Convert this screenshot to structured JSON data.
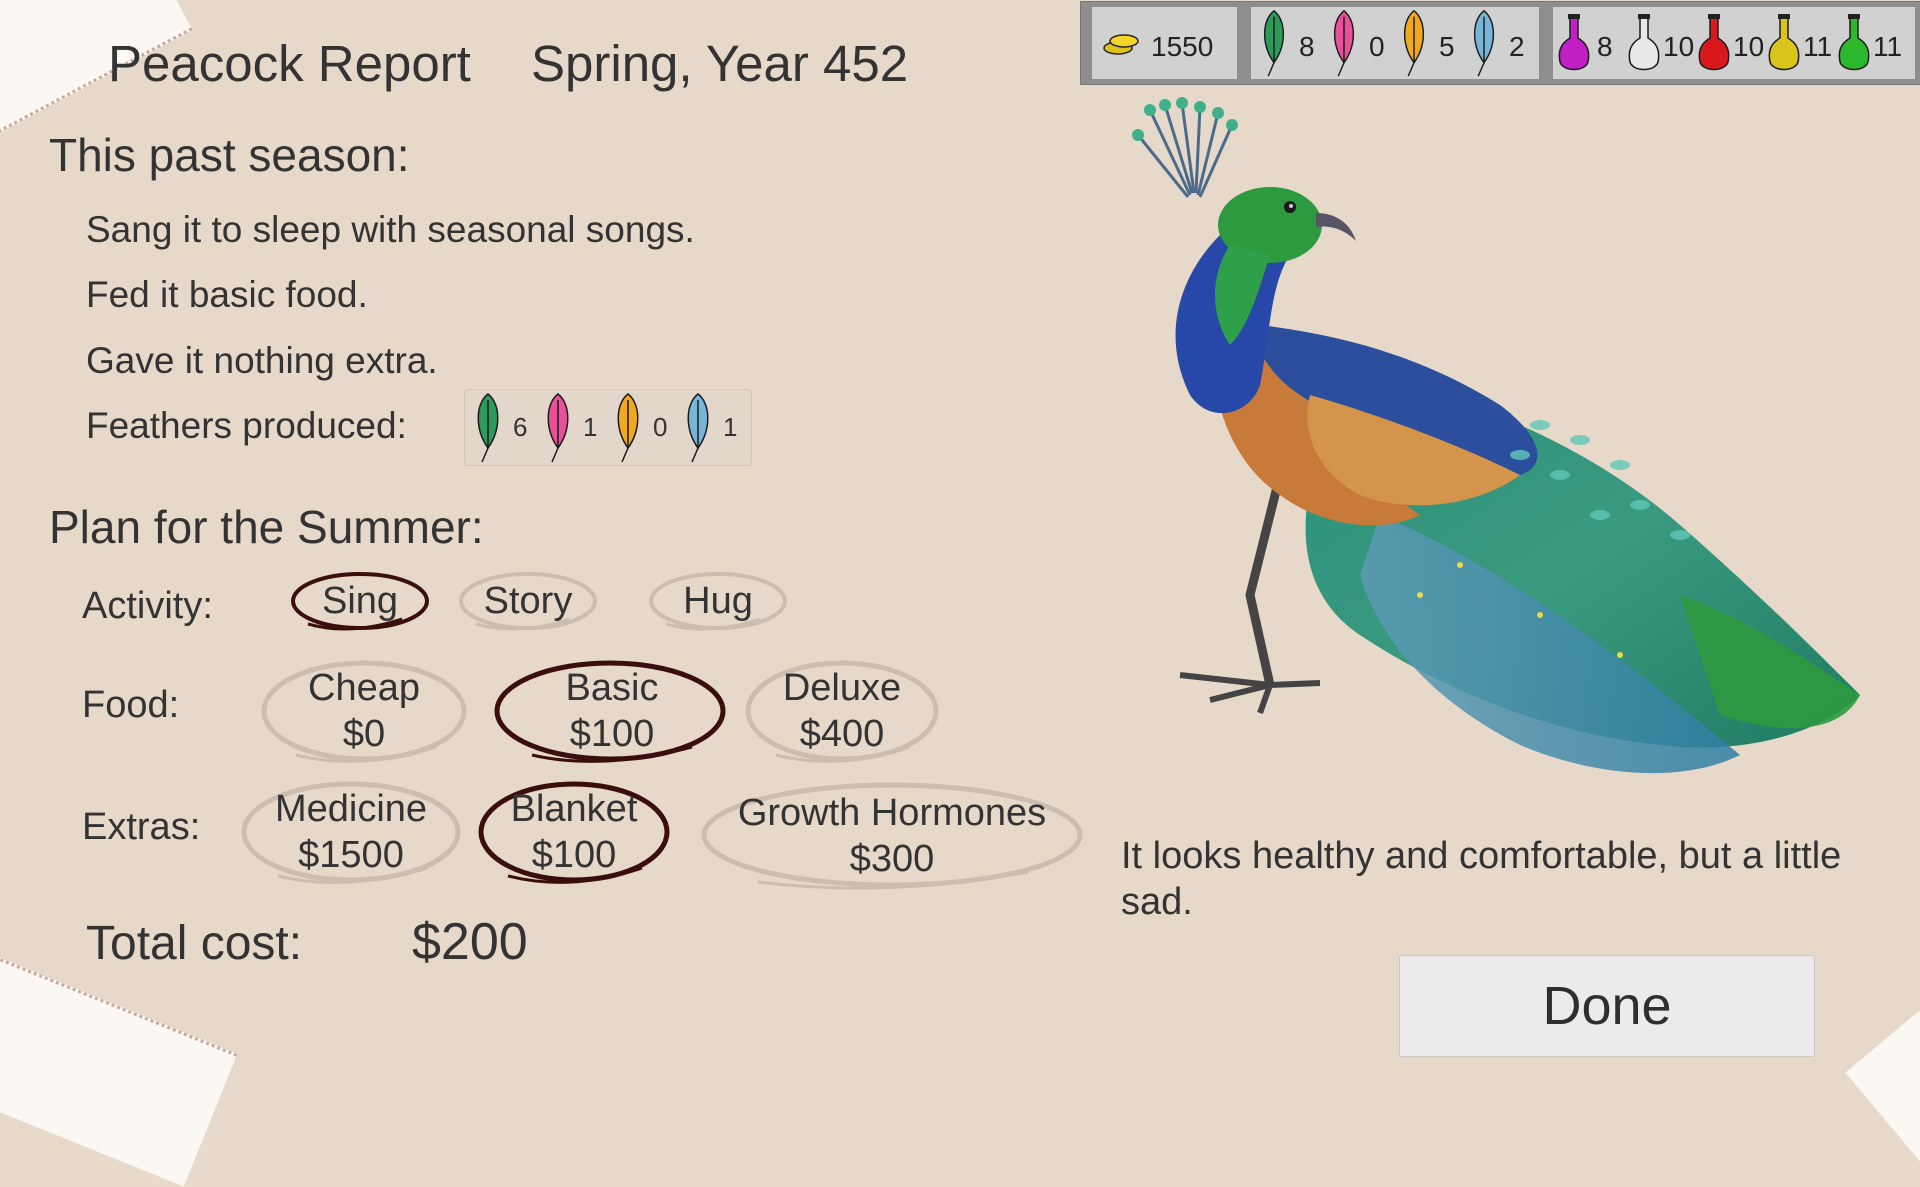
{
  "header": {
    "title": "Peacock Report",
    "season": "Spring, Year 452"
  },
  "past_season": {
    "heading": "This past season:",
    "lines": [
      "Sang it to sleep with seasonal songs.",
      "Fed it basic food.",
      "Gave it nothing extra."
    ],
    "feathers_label": "Feathers produced:",
    "feathers": [
      {
        "color": "#2e9a5a",
        "count": "6"
      },
      {
        "color": "#e8509a",
        "count": "1"
      },
      {
        "color": "#f0a81e",
        "count": "0"
      },
      {
        "color": "#78b6d8",
        "count": "1"
      }
    ]
  },
  "plan": {
    "heading": "Plan for the Summer:",
    "activity": {
      "label": "Activity:",
      "options": [
        {
          "label": "Sing",
          "selected": true
        },
        {
          "label": "Story",
          "selected": false
        },
        {
          "label": "Hug",
          "selected": false
        }
      ]
    },
    "food": {
      "label": "Food:",
      "options": [
        {
          "name": "Cheap",
          "price": "$0",
          "selected": false
        },
        {
          "name": "Basic",
          "price": "$100",
          "selected": true
        },
        {
          "name": "Deluxe",
          "price": "$400",
          "selected": false
        }
      ]
    },
    "extras": {
      "label": "Extras:",
      "options": [
        {
          "name": "Medicine",
          "price": "$1500",
          "selected": false
        },
        {
          "name": "Blanket",
          "price": "$100",
          "selected": true
        },
        {
          "name": "Growth Hormones",
          "price": "$300",
          "selected": false
        }
      ]
    },
    "total_label": "Total cost:",
    "total_value": "$200"
  },
  "resources": {
    "gold": "1550",
    "feathers": [
      {
        "color": "#2e9a5a",
        "count": "8"
      },
      {
        "color": "#e8509a",
        "count": "0"
      },
      {
        "color": "#f0a81e",
        "count": "5"
      },
      {
        "color": "#78b6d8",
        "count": "2"
      }
    ],
    "potions": [
      {
        "color": "#c21fc8",
        "count": "8"
      },
      {
        "color": "#e8e8e8",
        "count": "10"
      },
      {
        "color": "#d8181c",
        "count": "10"
      },
      {
        "color": "#d8c41a",
        "count": "11"
      },
      {
        "color": "#2cb82c",
        "count": "11"
      }
    ]
  },
  "status_text": "It looks healthy and comfortable, but a little sad.",
  "done_label": "Done",
  "colors": {
    "selected_ring": "#3a0e0e",
    "unselected_ring": "#cbbdb0"
  }
}
